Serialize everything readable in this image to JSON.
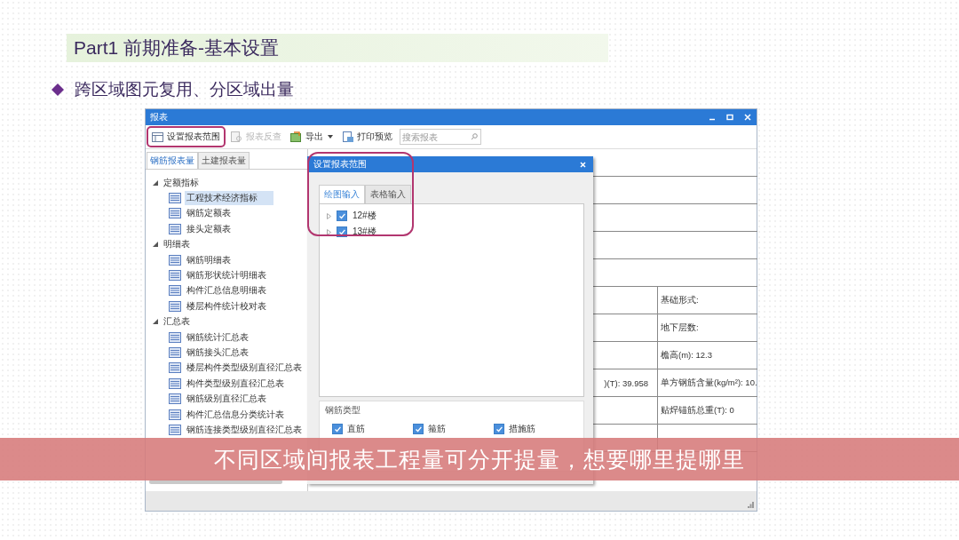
{
  "slide": {
    "title": "Part1 前期准备-基本设置",
    "bullet_text": "跨区域图元复用、分区域出量"
  },
  "window": {
    "title": "报表",
    "toolbar": [
      {
        "kind": "button",
        "label": "设置报表范围",
        "disabled": false,
        "highlighted": true
      },
      {
        "kind": "button",
        "label": "报表反查",
        "disabled": true,
        "highlighted": false
      },
      {
        "kind": "dropdown",
        "label": "导出",
        "disabled": false,
        "highlighted": false
      },
      {
        "kind": "button",
        "label": "打印预览",
        "disabled": false,
        "highlighted": false
      }
    ],
    "search": {
      "placeholder": "搜索报表"
    },
    "tabs": [
      {
        "label": "钢筋报表量",
        "selected": true
      },
      {
        "label": "土建报表量",
        "selected": false
      }
    ],
    "tree": [
      {
        "label": "定额指标",
        "expanded": true,
        "children": [
          {
            "label": "工程技术经济指标",
            "selected": true
          },
          {
            "label": "钢筋定额表",
            "selected": false
          },
          {
            "label": "接头定额表",
            "selected": false
          }
        ]
      },
      {
        "label": "明细表",
        "expanded": true,
        "children": [
          {
            "label": "钢筋明细表",
            "selected": false
          },
          {
            "label": "钢筋形状统计明细表",
            "selected": false
          },
          {
            "label": "构件汇总信息明细表",
            "selected": false
          },
          {
            "label": "楼层构件统计校对表",
            "selected": false
          }
        ]
      },
      {
        "label": "汇总表",
        "expanded": true,
        "children": [
          {
            "label": "钢筋统计汇总表",
            "selected": false
          },
          {
            "label": "钢筋接头汇总表",
            "selected": false
          },
          {
            "label": "楼层构件类型级别直径汇总表",
            "selected": false
          },
          {
            "label": "构件类型级别直径汇总表",
            "selected": false
          },
          {
            "label": "钢筋级别直径汇总表",
            "selected": false
          },
          {
            "label": "构件汇总信息分类统计表",
            "selected": false
          },
          {
            "label": "钢筋连接类型级别直径汇总表",
            "selected": false
          }
        ]
      }
    ],
    "report_rows": [
      {
        "column_2": "基础形式:"
      },
      {
        "column_2": "地下层数:"
      },
      {
        "column_2": "檐高(m): 12.3"
      },
      {
        "column_1": ")(T): 39.958",
        "column_2": "单方钢筋含量(kg/m²): 10."
      },
      {
        "column_2": "贴焊锚筋总重(T): 0"
      }
    ]
  },
  "dialog": {
    "title": "设置报表范围",
    "highlighted": true,
    "tabs": [
      {
        "label": "绘图输入",
        "selected": true
      },
      {
        "label": "表格输入",
        "selected": false
      }
    ],
    "items": [
      {
        "label": "12#楼",
        "checked": true,
        "expanded": false
      },
      {
        "label": "13#楼",
        "checked": true,
        "expanded": false
      }
    ],
    "group": {
      "title": "钢筋类型",
      "options": [
        {
          "label": "直筋",
          "checked": true
        },
        {
          "label": "箍筋",
          "checked": true
        },
        {
          "label": "措施筋",
          "checked": true
        }
      ]
    }
  },
  "caption": "不同区域间报表工程量可分开提量，想要哪里提哪里"
}
